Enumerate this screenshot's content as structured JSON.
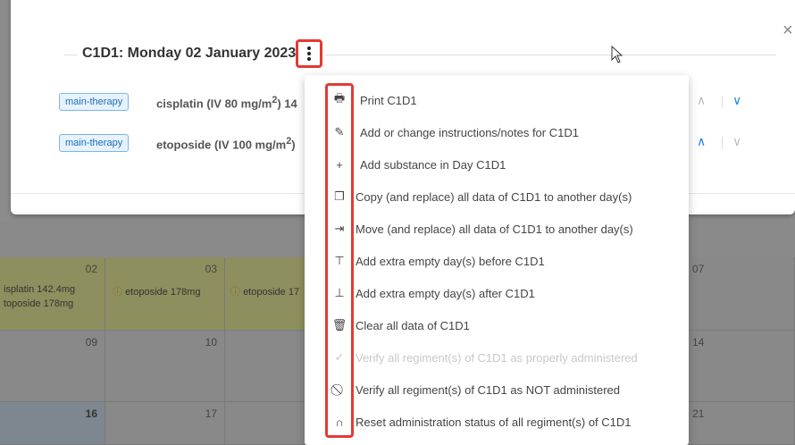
{
  "dialog": {
    "title": "C1D1: Monday 02 January 2023",
    "close_label": "×"
  },
  "regimens": [
    {
      "tag": "main-therapy",
      "drug_prefix": "cisplatin (IV 80 mg/m",
      "drug_sup": "2",
      "drug_suffix": ") 14",
      "up_active": false,
      "down_active": true
    },
    {
      "tag": "main-therapy",
      "drug_prefix": "etoposide (IV 100 mg/m",
      "drug_sup": "2",
      "drug_suffix": ")",
      "up_active": true,
      "down_active": false
    }
  ],
  "menu": {
    "items": [
      {
        "label": "Print C1D1",
        "icon": "printer-icon",
        "glyph": "🖶",
        "disabled": false
      },
      {
        "label": "Add or change instructions/notes for C1D1",
        "icon": "pencil-icon",
        "glyph": "✎",
        "disabled": false
      },
      {
        "label": "Add substance in Day C1D1",
        "icon": "plus-icon",
        "glyph": "+",
        "disabled": false
      },
      {
        "label": "Copy (and replace) all data of C1D1 to another day(s)",
        "icon": "copy-icon",
        "glyph": "❐",
        "disabled": false
      },
      {
        "label": "Move (and replace) all data of C1D1 to another day(s)",
        "icon": "move-icon",
        "glyph": "⇥",
        "disabled": false
      },
      {
        "label": "Add extra empty day(s) before C1D1",
        "icon": "insert-before-icon",
        "glyph": "⊤",
        "disabled": false
      },
      {
        "label": "Add extra empty day(s) after C1D1",
        "icon": "insert-after-icon",
        "glyph": "⊥",
        "disabled": false
      },
      {
        "label": "Clear all data of C1D1",
        "icon": "trash-icon",
        "glyph": "🗑",
        "disabled": false
      },
      {
        "label": "Verify all regiment(s) of C1D1 as properly administered",
        "icon": "check-icon",
        "glyph": "✓",
        "disabled": true
      },
      {
        "label": "Verify all regiment(s) of C1D1 as NOT administered",
        "icon": "block-icon",
        "glyph": "⃠",
        "disabled": false
      },
      {
        "label": "Reset administration status of all regiment(s) of C1D1",
        "icon": "reset-icon",
        "glyph": "∩",
        "disabled": false
      }
    ]
  },
  "calendar": {
    "row1": [
      "02",
      "03",
      "07"
    ],
    "row1_events": {
      "d02": [
        "isplatin 142.4mg",
        "toposide 178mg"
      ],
      "d03": "etoposide 178mg",
      "d04": "etoposide 17"
    },
    "row2": [
      "09",
      "10",
      "14"
    ],
    "row3": [
      "16",
      "17",
      "21"
    ]
  },
  "colors": {
    "accent": "#1e88e5",
    "highlight_border": "#e53935",
    "tag_text": "#1c6fb8"
  }
}
